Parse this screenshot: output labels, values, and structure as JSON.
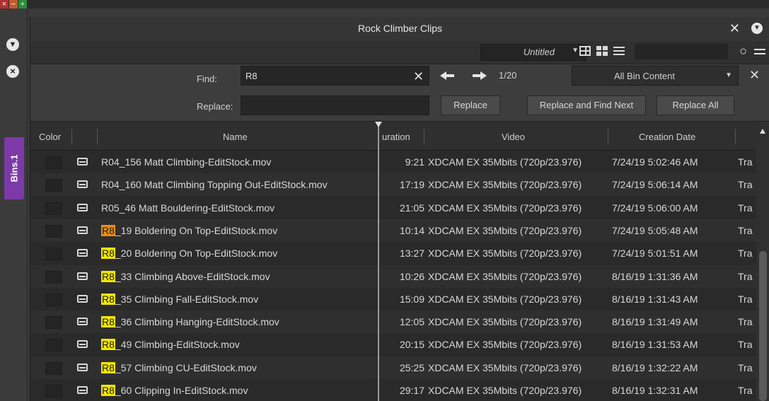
{
  "host": {
    "close_glyph": "×",
    "min_glyph": "−",
    "add_glyph": "+",
    "side_tab_label": "Bins.1"
  },
  "window": {
    "title": "Rock Climber Clips",
    "close_glyph": "✕",
    "view_name": "Untitled"
  },
  "find": {
    "find_label": "Find:",
    "find_value": "R8",
    "replace_label": "Replace:",
    "replace_value": "",
    "count": "1/20",
    "scope": "All Bin Content",
    "clear_glyph": "✕",
    "close_glyph": "✕",
    "replace_button": "Replace",
    "replace_find_next_button": "Replace and Find Next",
    "replace_all_button": "Replace All"
  },
  "columns": {
    "color": "Color",
    "name": "Name",
    "duration": "uration",
    "video": "Video",
    "creation_date": "Creation Date"
  },
  "rows": [
    {
      "prefix": "",
      "rest": "R04_156 Matt Climbing-EditStock.mov",
      "duration": "9:21",
      "video": "XDCAM EX 35Mbits (720p/23.976)",
      "date": "7/24/19 5:02:46 AM",
      "extra": "Tra"
    },
    {
      "prefix": "",
      "rest": "R04_160 Matt Climbing Topping Out-EditStock.mov",
      "duration": "17:19",
      "video": "XDCAM EX 35Mbits (720p/23.976)",
      "date": "7/24/19 5:06:14 AM",
      "extra": "Tra"
    },
    {
      "prefix": "",
      "rest": "R05_46 Matt Bouldering-EditStock.mov",
      "duration": "21:05",
      "video": "XDCAM EX 35Mbits (720p/23.976)",
      "date": "7/24/19 5:06:00 AM",
      "extra": "Tra"
    },
    {
      "prefix": "R8",
      "rest": "_19 Boldering On Top-EditStock.mov",
      "duration": "10:14",
      "video": "XDCAM EX 35Mbits (720p/23.976)",
      "date": "7/24/19 5:05:48 AM",
      "extra": "Tra",
      "current": true
    },
    {
      "prefix": "R8",
      "rest": "_20 Boldering On Top-EditStock.mov",
      "duration": "13:27",
      "video": "XDCAM EX 35Mbits (720p/23.976)",
      "date": "7/24/19 5:01:51 AM",
      "extra": "Tra"
    },
    {
      "prefix": "R8",
      "rest": "_33 Climbing Above-EditStock.mov",
      "duration": "10:26",
      "video": "XDCAM EX 35Mbits (720p/23.976)",
      "date": "8/16/19 1:31:36 AM",
      "extra": "Tra"
    },
    {
      "prefix": "R8",
      "rest": "_35 Climbing Fall-EditStock.mov",
      "duration": "15:09",
      "video": "XDCAM EX 35Mbits (720p/23.976)",
      "date": "8/16/19 1:31:43 AM",
      "extra": "Tra"
    },
    {
      "prefix": "R8",
      "rest": "_36 Climbing Hanging-EditStock.mov",
      "duration": "12:05",
      "video": "XDCAM EX 35Mbits (720p/23.976)",
      "date": "8/16/19 1:31:49 AM",
      "extra": "Tra"
    },
    {
      "prefix": "R8",
      "rest": "_49 Climbing-EditStock.mov",
      "duration": "20:15",
      "video": "XDCAM EX 35Mbits (720p/23.976)",
      "date": "8/16/19 1:31:53 AM",
      "extra": "Tra"
    },
    {
      "prefix": "R8",
      "rest": "_57 Climbing CU-EditStock.mov",
      "duration": "25:25",
      "video": "XDCAM EX 35Mbits (720p/23.976)",
      "date": "8/16/19 1:32:22 AM",
      "extra": "Tra"
    },
    {
      "prefix": "R8",
      "rest": "_60 Clipping In-EditStock.mov",
      "duration": "29:17",
      "video": "XDCAM EX 35Mbits (720p/23.976)",
      "date": "8/16/19 1:32:31 AM",
      "extra": "Tra"
    }
  ],
  "colors": {
    "highlight_match": "#f2e600",
    "highlight_current": "#e88f17",
    "bins_tab": "#7c3aa8"
  }
}
